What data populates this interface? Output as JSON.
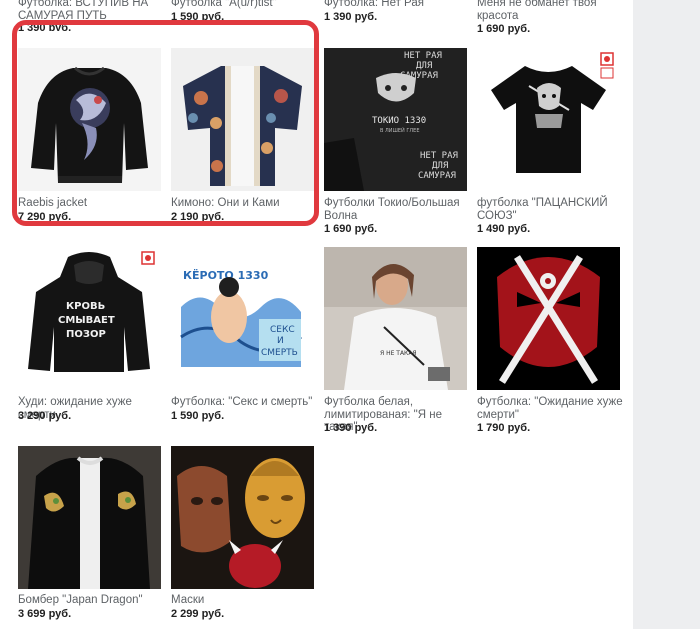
{
  "colors": {
    "highlight_border": "#e0393e",
    "title_text": "#5e6266",
    "price_text": "#222222",
    "page_bg": "#ffffff",
    "gutter_bg": "#edeef0"
  },
  "partial_top": [
    {
      "title": "Футболка: ВСТУПИВ НА САМУРАЯ ПУТЬ",
      "price": "1 390 руб."
    },
    {
      "title": "Футболка \"A(u/r)tist\"",
      "price": "1 590 руб."
    },
    {
      "title": "Футболка: Нет Рая",
      "price": "1 390 руб."
    },
    {
      "title": "Меня не обманет твоя красота",
      "price": "1 690 руб."
    }
  ],
  "products": [
    {
      "title": "Raebis jacket",
      "price": "7 290 руб.",
      "image": "black-embroidered-jacket"
    },
    {
      "title": "Кимоно: Они и Ками",
      "price": "2 190 руб.",
      "image": "printed-kimono"
    },
    {
      "title": "Футболки Токио/Большая Волна",
      "price": "1 690 руб.",
      "image": "tokyo-1330-tshirts",
      "image_text": [
        "НЕТ РАЯ",
        "ДЛЯ",
        "САМУРАЯ",
        "ТОКИО 1330",
        "В ЛИШЕЙ ГЛЕЕ"
      ]
    },
    {
      "title": "футболка \"ПАЦАНСКИЙ СОЮЗ\"",
      "price": "1 490 руб.",
      "image": "black-samurai-tshirt"
    },
    {
      "title": "Худи: ожидание хуже смерти",
      "price": "3 290 руб.",
      "image": "black-hoodie",
      "image_text": [
        "КРОВЬ",
        "СМЫВАЕТ",
        "ПОЗОР"
      ]
    },
    {
      "title": "Футболка: \"Секс и смерть\"",
      "price": "1 590 руб.",
      "image": "sex-and-death-print",
      "image_text": [
        "КЁРОТО 1330",
        "СЕКС",
        "И",
        "СМЕРТЬ"
      ]
    },
    {
      "title": "Футболка белая, лимитированая: \"Я не такая\"",
      "price": "1 390 руб.",
      "image": "woman-in-white-tshirt"
    },
    {
      "title": "Футболка: \"Ожидание хуже смерти\"",
      "price": "1 790 руб.",
      "image": "crossed-swords-mask"
    },
    {
      "title": "Бомбер \"Japan Dragon\"",
      "price": "3 699 руб.",
      "image": "black-dragon-bomber"
    },
    {
      "title": "Маски",
      "price": "2 299 руб.",
      "image": "masks-buddha-oni"
    }
  ]
}
